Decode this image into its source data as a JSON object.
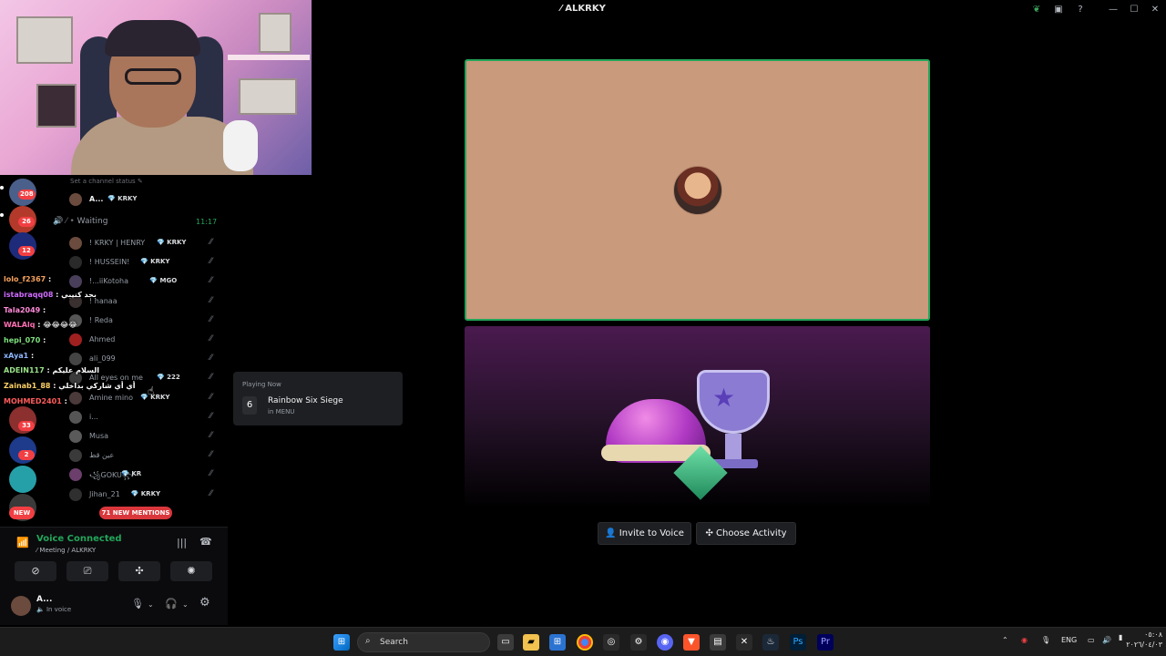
{
  "window": {
    "title": "ALKRKY"
  },
  "webcam": {},
  "rail": {
    "badges": [
      "208",
      "26",
      "12",
      "33",
      "2"
    ],
    "new_label": "NEW"
  },
  "channel": {
    "status_hint": "Set a channel status",
    "top_member": {
      "name": "A...",
      "tag": "KRKY"
    },
    "waiting_channel": "Waiting",
    "waiting_time": "11:17",
    "members": [
      {
        "name": "! KRKY | HENRY",
        "tag": "KRKY"
      },
      {
        "name": "! HUSSEIN!",
        "tag": "KRKY"
      },
      {
        "name": "!...iiKotoha",
        "tag": "MGO"
      },
      {
        "name": "! hanaa",
        "tag": ""
      },
      {
        "name": "! Reda",
        "tag": ""
      },
      {
        "name": "Ahmed",
        "tag": ""
      },
      {
        "name": "ali_099",
        "tag": ""
      },
      {
        "name": "All eyes on me",
        "tag": "222"
      },
      {
        "name": "Amine mino",
        "tag": "KRKY"
      },
      {
        "name": "i...",
        "tag": ""
      },
      {
        "name": "Musa",
        "tag": ""
      },
      {
        "name": "عين قط",
        "tag": ""
      },
      {
        "name": "꧁GOKU꧂",
        "tag": "KR"
      },
      {
        "name": "Jihan_21",
        "tag": "KRKY"
      }
    ],
    "mentions": "71 NEW MENTIONS"
  },
  "chat": [
    {
      "user": "lolo_f2367",
      "text": "",
      "color": "#f5a25d"
    },
    {
      "user": "istabraqq08",
      "text": "بحد كنيبي",
      "color": "#d16cff"
    },
    {
      "user": "Tala2049",
      "text": "",
      "color": "#ff8ad8"
    },
    {
      "user": "WALAlq",
      "text": "😂😂😂😂",
      "color": "#ff6fb3"
    },
    {
      "user": "hepi_070",
      "text": "",
      "color": "#7ee07e"
    },
    {
      "user": "xAya1",
      "text": "",
      "color": "#8fb7ff"
    },
    {
      "user": "ADEIN117",
      "text": "السلام عليكم",
      "color": "#9be38a"
    },
    {
      "user": "Zainab1_88",
      "text": "أي أي شاركي بداخلي",
      "color": "#ffd166"
    },
    {
      "user": "MOHMED2401",
      "text": "",
      "color": "#ff5c5c"
    }
  ],
  "playing": {
    "header": "Playing Now",
    "game": "Rainbow Six Siege",
    "sub": "in MENU"
  },
  "voice": {
    "status": "Voice Connected",
    "location": "Meeting / ALKRKY"
  },
  "user": {
    "name": "A...",
    "status": "In voice"
  },
  "activity": {
    "invite_label": "Invite to Voice",
    "choose_label": "Choose Activity"
  },
  "taskbar": {
    "search_label": "Search",
    "lang": "ENG",
    "time": "٠٥:٠٨",
    "date": "٢٠٢٦/٠٤/٠٣"
  }
}
